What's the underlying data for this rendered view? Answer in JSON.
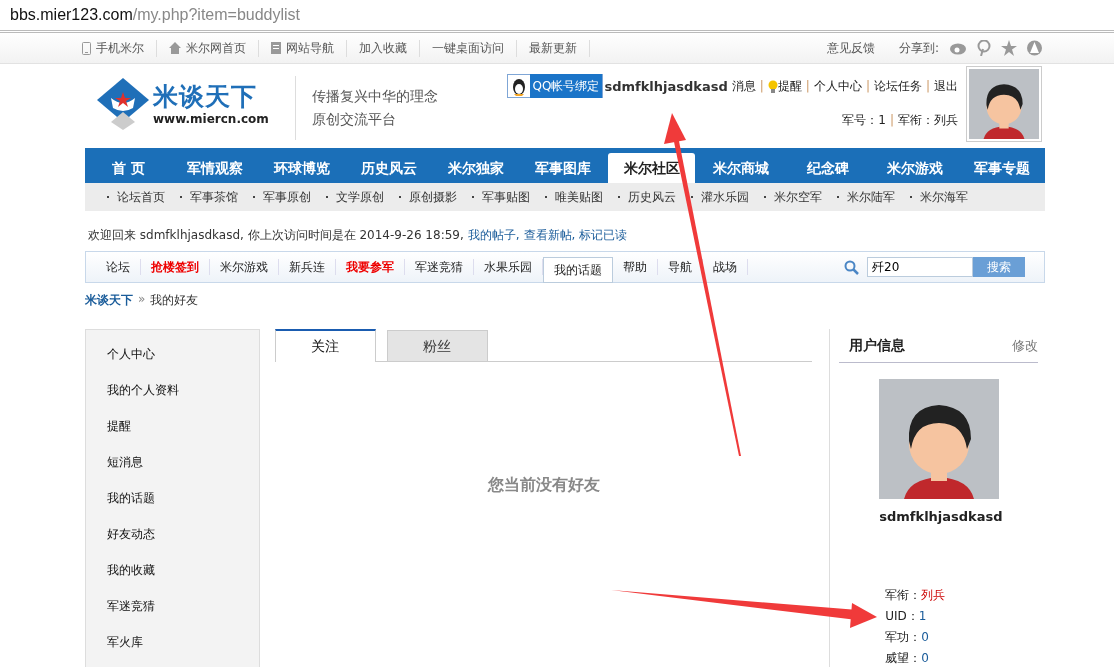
{
  "address_bar": {
    "host": "bbs.mier123.com",
    "path": "/my.php?item=buddylist"
  },
  "top_bar": {
    "links": [
      {
        "label": "手机米尔",
        "kind": "phone"
      },
      {
        "label": "米尔网首页",
        "kind": "home"
      },
      {
        "label": "网站导航",
        "kind": "doc"
      },
      {
        "label": "加入收藏",
        "kind": "plain"
      },
      {
        "label": "一键桌面访问",
        "kind": "plain"
      },
      {
        "label": "最新更新",
        "kind": "plain"
      }
    ],
    "feedback": "意见反馈",
    "share_label": "分享到:"
  },
  "header": {
    "logo_text": "米谈天下",
    "logo_url": "www.miercn.com",
    "slogan": [
      "传播复兴中华的理念",
      "原创交流平台"
    ],
    "qq_button": "QQ帐号绑定",
    "separator": "|",
    "username": "sdmfklhjasdkasd",
    "user_links": [
      {
        "label": "消息",
        "kind": "plain"
      },
      {
        "label": "提醒",
        "kind": "bulb"
      },
      {
        "label": "个人中心",
        "kind": "plain"
      },
      {
        "label": "论坛任务",
        "kind": "plain"
      },
      {
        "label": "退出",
        "kind": "plain"
      }
    ],
    "rank": [
      {
        "label": "军号：",
        "value": "1"
      },
      {
        "label": "军衔：",
        "value": "列兵"
      }
    ]
  },
  "main_nav": [
    {
      "label": "首 页",
      "selected": false
    },
    {
      "label": "军情观察",
      "selected": false
    },
    {
      "label": "环球博览",
      "selected": false
    },
    {
      "label": "历史风云",
      "selected": false
    },
    {
      "label": "米尔独家",
      "selected": false
    },
    {
      "label": "军事图库",
      "selected": false
    },
    {
      "label": "米尔社区",
      "selected": true
    },
    {
      "label": "米尔商城",
      "selected": false
    },
    {
      "label": "纪念碑",
      "selected": false
    },
    {
      "label": "米尔游戏",
      "selected": false
    },
    {
      "label": "军事专题",
      "selected": false
    }
  ],
  "sub_nav": [
    "论坛首页",
    "军事茶馆",
    "军事原创",
    "文学原创",
    "原创摄影",
    "军事贴图",
    "唯美贴图",
    "历史风云",
    "灌水乐园",
    "米尔空军",
    "米尔陆军",
    "米尔海军"
  ],
  "welcome": {
    "text": "欢迎回来 sdmfklhjasdkasd, 你上次访问时间是在 2014-9-26 18:59,",
    "links": [
      "我的帖子,",
      "查看新帖,",
      "标记已读"
    ]
  },
  "forum_nav": {
    "items": [
      {
        "label": "论坛",
        "kind": "plain",
        "selected": false
      },
      {
        "label": "抢楼签到",
        "kind": "hot",
        "selected": false
      },
      {
        "label": "米尔游戏",
        "kind": "plain",
        "selected": false
      },
      {
        "label": "新兵连",
        "kind": "plain",
        "selected": false
      },
      {
        "label": "我要参军",
        "kind": "hot",
        "selected": false
      },
      {
        "label": "军迷竞猜",
        "kind": "plain",
        "selected": false
      },
      {
        "label": "水果乐园",
        "kind": "plain",
        "selected": false
      },
      {
        "label": "我的话题",
        "kind": "plain",
        "selected": true
      },
      {
        "label": "帮助",
        "kind": "plain",
        "selected": false
      },
      {
        "label": "导航",
        "kind": "plain",
        "selected": false
      },
      {
        "label": "战场",
        "kind": "plain",
        "selected": false
      }
    ],
    "search": {
      "value": "歼20",
      "button": "搜索"
    }
  },
  "breadcrumb": {
    "items": [
      "米谈天下",
      "我的好友"
    ],
    "separator": "»"
  },
  "sidebar": [
    "个人中心",
    "我的个人资料",
    "提醒",
    "短消息",
    "我的话题",
    "好友动态",
    "我的收藏",
    "军迷竞猜",
    "军火库"
  ],
  "tabs": [
    {
      "label": "关注",
      "selected": true
    },
    {
      "label": "粉丝",
      "selected": false
    }
  ],
  "empty_message": "您当前没有好友",
  "user_info": {
    "title": "用户信息",
    "edit": "修改",
    "username": "sdmfklhjasdkasd",
    "fields": [
      {
        "label": "军衔：",
        "value": "列兵",
        "kind": "rank"
      },
      {
        "label": "UID：",
        "value": "1",
        "kind": "number"
      },
      {
        "label": "军功：",
        "value": "0",
        "kind": "number"
      },
      {
        "label": "威望：",
        "value": "0",
        "kind": "number"
      }
    ]
  }
}
